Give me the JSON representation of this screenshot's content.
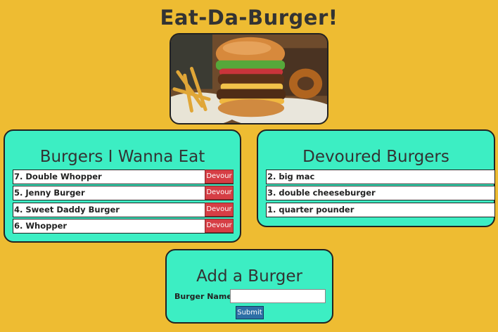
{
  "header": {
    "title": "Eat-Da-Burger!"
  },
  "hero_image": {
    "icon": "burger-image"
  },
  "eat_panel": {
    "title": "Burgers I Wanna Eat",
    "button_label": "Devour",
    "items": [
      {
        "label": "7. Double Whopper"
      },
      {
        "label": "5. Jenny Burger"
      },
      {
        "label": "4. Sweet Daddy Burger"
      },
      {
        "label": "6. Whopper"
      }
    ]
  },
  "devoured_panel": {
    "title": "Devoured Burgers",
    "items": [
      {
        "label": "2. big mac"
      },
      {
        "label": "3. double cheeseburger"
      },
      {
        "label": "1. quarter pounder"
      }
    ]
  },
  "add_panel": {
    "title": "Add a Burger",
    "field_label": "Burger Name:",
    "field_value": "",
    "submit_label": "Submit"
  },
  "colors": {
    "background": "#eebc32",
    "panel": "#3ceec3",
    "devour_button": "#d63e45",
    "submit_button": "#2d6fa6"
  }
}
